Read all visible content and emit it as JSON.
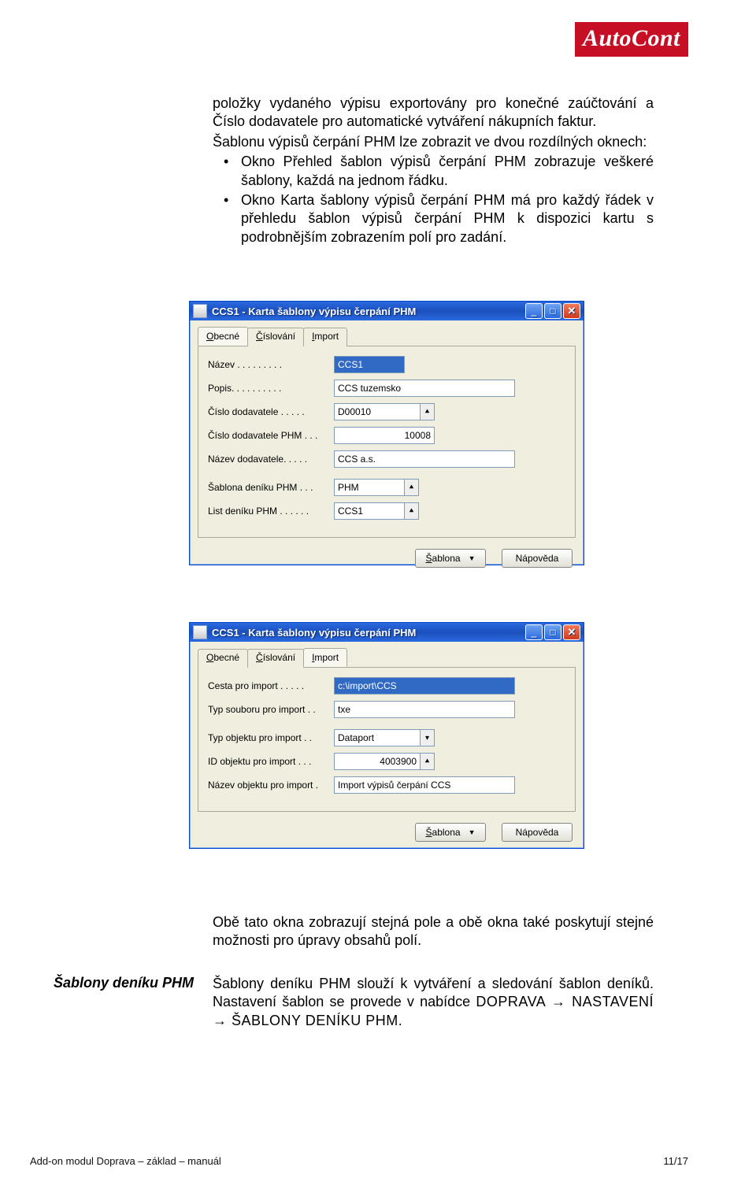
{
  "logo": {
    "text": "AutoCont"
  },
  "intro": {
    "p1": "položky vydaného výpisu exportovány pro konečné zaúčtování a Číslo dodavatele pro automatické vytváření nákupních faktur.",
    "p2": "Šablonu výpisů čerpání PHM lze zobrazit ve dvou rozdílných oknech:",
    "li1": "Okno Přehled šablon výpisů čerpání PHM zobrazuje veškeré šablony, každá na jednom řádku.",
    "li2": "Okno Karta šablony výpisů čerpání PHM má pro každý řádek v přehledu šablon výpisů čerpání PHM k dispozici kartu s podrobnějším zobrazením polí pro zadání."
  },
  "window1": {
    "title": "CCS1 - Karta šablony výpisu čerpání PHM",
    "tab_obecne_letter": "O",
    "tab_obecne_rest": "becné",
    "tab_cislovani_letter": "Č",
    "tab_cislovani_rest": "íslování",
    "tab_import_letter": "I",
    "tab_import_rest": "mport",
    "lbl_nazev": "Název  .  .  .  .  .  .  .  .  .",
    "val_nazev": "CCS1",
    "lbl_popis": "Popis.  .  .  .  .  .  .  .  .  .",
    "val_popis": "CCS tuzemsko",
    "lbl_cdod": "Číslo dodavatele  .  .  .  .  .",
    "val_cdod": "D00010",
    "lbl_cdodphm": "Číslo dodavatele PHM .  .  .",
    "val_cdodphm": "10008",
    "lbl_ndod": "Název dodavatele.  .  .  .  .",
    "val_ndod": "CCS a.s.",
    "lbl_sdenik": "Šablona deníku PHM  .  .  .",
    "val_sdenik": "PHM",
    "lbl_ldenik": "List deníku PHM .  .  .  .  .  .",
    "val_ldenik": "CCS1"
  },
  "window2": {
    "title": "CCS1 - Karta šablony výpisu čerpání PHM",
    "lbl_cesta": "Cesta pro import .  .  .  .  .",
    "val_cesta": "c:\\import\\CCS",
    "lbl_typs": "Typ souboru pro import .  .",
    "val_typs": "txe",
    "lbl_typo": "Typ objektu pro import  .  .",
    "val_typo": "Dataport",
    "lbl_ido": "ID objektu pro import .  .  .",
    "val_ido": "4003900",
    "lbl_nazo": "Název objektu pro import  .",
    "val_nazo": "Import výpisů čerpání CCS"
  },
  "buttons": {
    "sablona_ul": "Š",
    "sablona_rest": "ablona",
    "napoveda": "Nápověda"
  },
  "after1": "Obě tato okna zobrazují stejná pole a obě okna také poskytují stejné možnosti pro úpravy obsahů polí.",
  "sideheading": "Šablony deníku PHM",
  "after2_a": "Šablony deníku PHM slouží k vytváření a sledování šablon deníků. Nastavení šablon se provede v nabídce ",
  "after2_caps": "DOPRAVA → NASTAVENÍ → ŠABLONY DENÍKU PHM.",
  "footer": {
    "left": "Add-on modul Doprava – základ – manuál",
    "right": "11/17"
  }
}
